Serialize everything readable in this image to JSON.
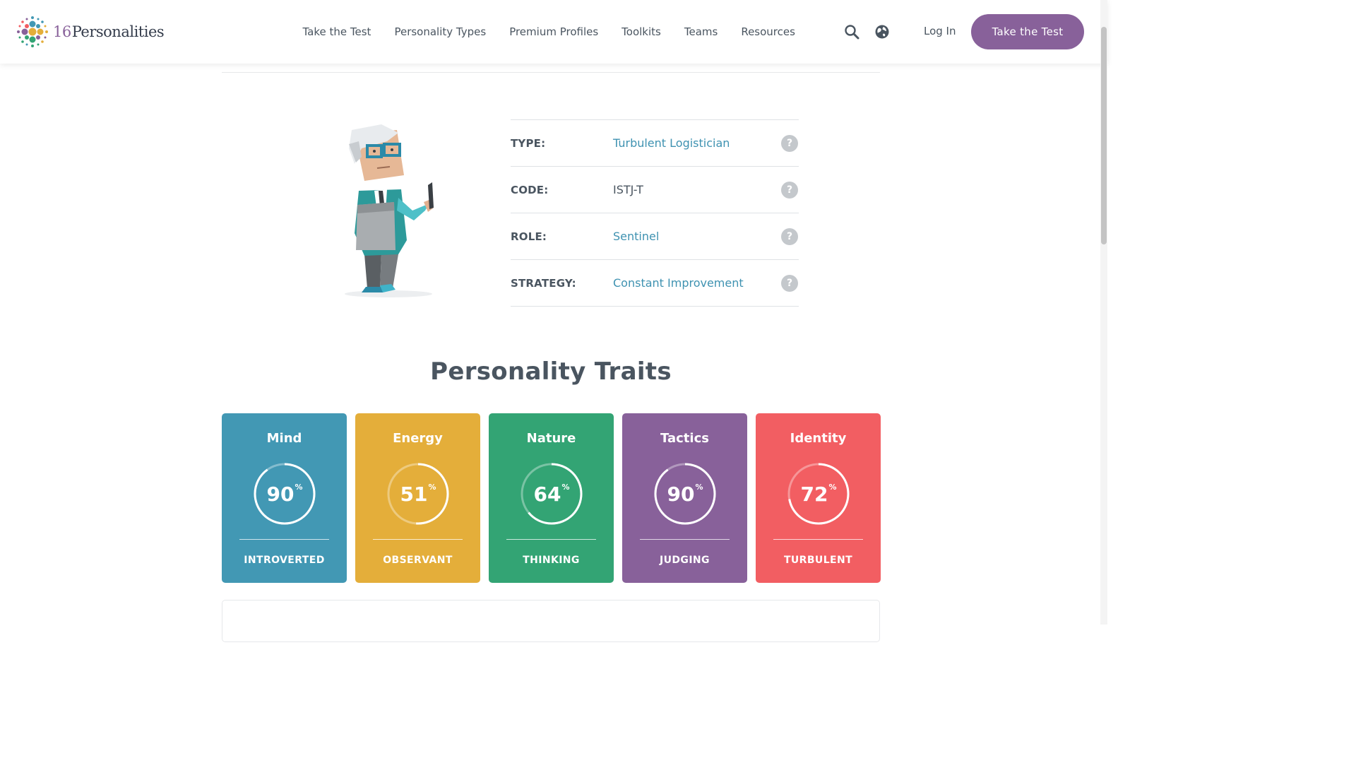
{
  "header": {
    "logo_num": "16",
    "logo_word": "Personalities",
    "nav": [
      "Take the Test",
      "Personality Types",
      "Premium Profiles",
      "Toolkits",
      "Teams",
      "Resources"
    ],
    "icons": [
      "search-icon",
      "globe-icon"
    ],
    "login": "Log In",
    "cta": "Take the Test"
  },
  "profile": {
    "rows": [
      {
        "key": "TYPE:",
        "value": "Turbulent Logistician",
        "link": true
      },
      {
        "key": "CODE:",
        "value": "ISTJ-T",
        "link": false
      },
      {
        "key": "ROLE:",
        "value": "Sentinel",
        "link": true
      },
      {
        "key": "STRATEGY:",
        "value": "Constant Improvement",
        "link": true
      }
    ],
    "help_glyph": "?"
  },
  "traits": {
    "title": "Personality Traits",
    "percent_symbol": "%",
    "cards": [
      {
        "name": "Mind",
        "percent": 90,
        "trait": "INTROVERTED",
        "color": "#4298b4"
      },
      {
        "name": "Energy",
        "percent": 51,
        "trait": "OBSERVANT",
        "color": "#e4ae3a"
      },
      {
        "name": "Nature",
        "percent": 64,
        "trait": "THINKING",
        "color": "#33a474"
      },
      {
        "name": "Tactics",
        "percent": 90,
        "trait": "JUDGING",
        "color": "#88619a"
      },
      {
        "name": "Identity",
        "percent": 72,
        "trait": "TURBULENT",
        "color": "#f25e62"
      }
    ]
  },
  "colors": {
    "brand": "#88619a",
    "link": "#3f92b1",
    "text": "#4a5560"
  }
}
